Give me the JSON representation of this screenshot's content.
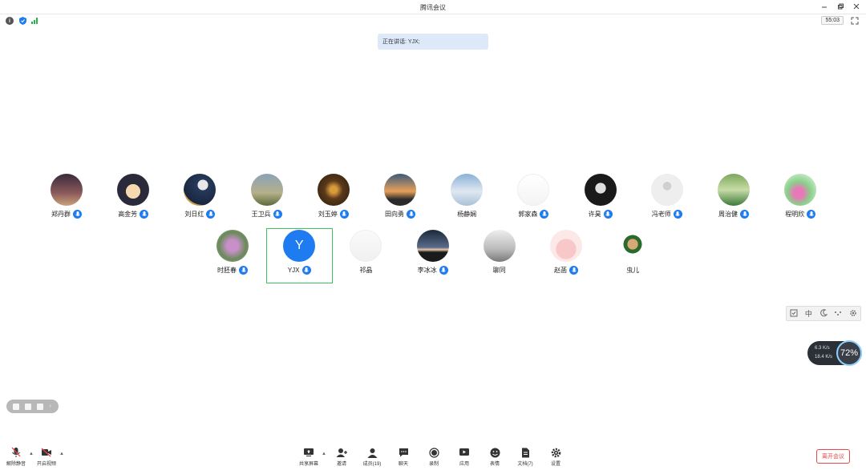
{
  "window": {
    "title": "腾讯会议"
  },
  "status": {
    "timer": "55:03"
  },
  "banner": {
    "speaking": "正在讲话: YJX;"
  },
  "participants": [
    {
      "name": "郑丹群",
      "avatar": "couple-sunset"
    },
    {
      "name": "高金芳",
      "avatar": "cartoon-girl"
    },
    {
      "name": "刘日红",
      "avatar": "moon-boat"
    },
    {
      "name": "王卫兵",
      "avatar": "tree-field"
    },
    {
      "name": "刘玉婷",
      "avatar": "library"
    },
    {
      "name": "田向勇",
      "avatar": "mountain-dusk"
    },
    {
      "name": "杨静娴",
      "avatar": "snow-house"
    },
    {
      "name": "郭家森",
      "avatar": "bare-tree"
    },
    {
      "name": "许昊",
      "avatar": "astronaut"
    },
    {
      "name": "冯老师",
      "avatar": "default-user"
    },
    {
      "name": "周治健",
      "avatar": "garden"
    },
    {
      "name": "程明欣",
      "avatar": "flowers"
    },
    {
      "name": "时胚春",
      "avatar": "purple-flowers"
    },
    {
      "name": "YJX",
      "avatar": "letter",
      "initial": "Y"
    },
    {
      "name": "祁晶",
      "avatar": "document"
    },
    {
      "name": "李冰冰",
      "avatar": "dark-horizon"
    },
    {
      "name": "聊同",
      "avatar": "grey-tree"
    },
    {
      "name": "赵菡",
      "avatar": "pink-cute"
    },
    {
      "name": "虫儿",
      "avatar": "portrait-green"
    }
  ],
  "view_controls": {
    "middle_label": "中"
  },
  "network": {
    "up": "6.3 K/s",
    "down": "18.4 K/s",
    "cpu": "72%"
  },
  "toolbar": {
    "unmute": "解除静音",
    "start_video": "开启视频",
    "share_screen": "共享屏幕",
    "invite": "邀请",
    "members": "成员(19)",
    "chat": "聊天",
    "record": "录制",
    "apps": "应用",
    "reactions": "表情",
    "docs": "文档(7)",
    "settings": "设置",
    "leave": "离开会议"
  },
  "colors": {
    "accent": "#1f7cf0",
    "active_border": "#3cc060",
    "leave": "#e8474a"
  }
}
